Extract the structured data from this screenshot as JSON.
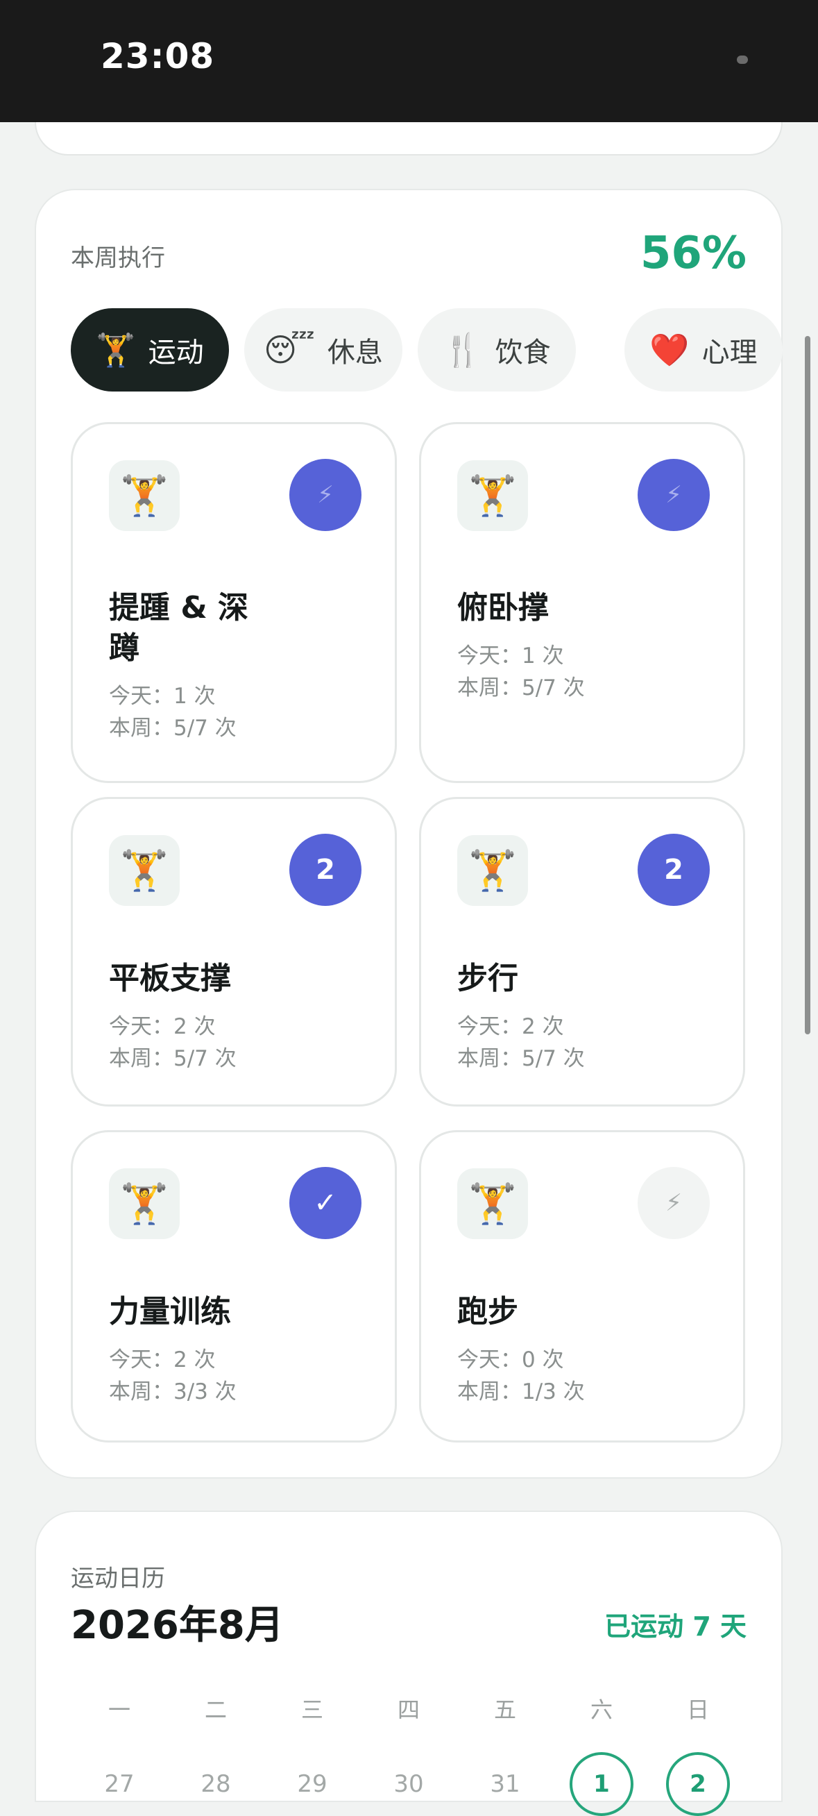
{
  "status_bar": {
    "time": "23:08"
  },
  "execution": {
    "label": "本周执行",
    "percent": "56%",
    "tabs": [
      {
        "emoji": "🏋️",
        "label": "运动",
        "active": true
      },
      {
        "emoji": "😴",
        "label": "休息",
        "active": false
      },
      {
        "emoji": "🍴",
        "label": "饮食",
        "active": false
      },
      {
        "emoji": "❤️",
        "label": "心理",
        "active": false
      }
    ],
    "items": [
      {
        "name": "提踵 & 深蹲",
        "today": "今天：1 次",
        "week": "本周：5/7 次",
        "badge": "⚡",
        "badge_type": "bolt"
      },
      {
        "name": "俯卧撑",
        "today": "今天：1 次",
        "week": "本周：5/7 次",
        "badge": "⚡",
        "badge_type": "bolt"
      },
      {
        "name": "平板支撑",
        "today": "今天：2 次",
        "week": "本周：5/7 次",
        "badge": "2",
        "badge_type": "count"
      },
      {
        "name": "步行",
        "today": "今天：2 次",
        "week": "本周：5/7 次",
        "badge": "2",
        "badge_type": "count"
      },
      {
        "name": "力量训练",
        "today": "今天：2 次",
        "week": "本周：3/3 次",
        "badge": "✓",
        "badge_type": "done"
      },
      {
        "name": "跑步",
        "today": "今天：0 次",
        "week": "本周：1/3 次",
        "badge": "⚡",
        "badge_type": "idle"
      }
    ],
    "item_emoji": "🏋️"
  },
  "calendar": {
    "label": "运动日历",
    "month": "2026年8月",
    "summary": "已运动 7 天",
    "weekdays": [
      "一",
      "二",
      "三",
      "四",
      "五",
      "六",
      "日"
    ],
    "first_row": [
      "27",
      "28",
      "29",
      "30",
      "31",
      "1",
      "2"
    ]
  }
}
